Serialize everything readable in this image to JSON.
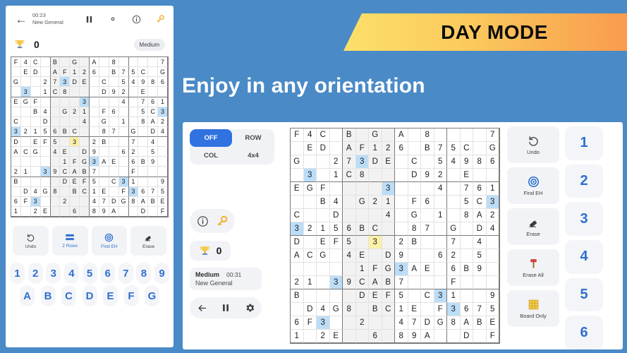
{
  "banner": {
    "label": "DAY MODE"
  },
  "headline": {
    "text": "Enjoy in any orientation"
  },
  "colors": {
    "background": "#4a8ac7",
    "accent_blue": "#2f72e0",
    "highlight_cell": "#bcddf7",
    "highlight_cell_yellow": "#fcf0a8",
    "banner_from": "#fbe06a",
    "banner_to": "#f99b4e",
    "panel_grey": "#f2f3f6"
  },
  "phone": {
    "topbar": {
      "back_icon": "arrow-left-icon",
      "time": "00:23",
      "puzzle_name": "New General",
      "pause_icon": "pause-icon",
      "settings_icon": "gear-icon",
      "info_icon": "info-icon",
      "key_icon": "key-icon"
    },
    "score": {
      "trophy_icon": "trophy-icon",
      "value": "0",
      "difficulty": "Medium"
    },
    "tools": [
      {
        "label": "Undo",
        "icon": "undo-icon",
        "active": false
      },
      {
        "label": "2 Rows",
        "icon": "rows-icon",
        "active": true
      },
      {
        "label": "Find EH",
        "icon": "target-icon",
        "active": false
      },
      {
        "label": "Erase",
        "icon": "eraser-icon",
        "active": false
      }
    ],
    "keypad_numbers": [
      "1",
      "2",
      "3",
      "4",
      "5",
      "6",
      "7",
      "8",
      "9"
    ],
    "keypad_letters": [
      "A",
      "B",
      "C",
      "D",
      "E",
      "F",
      "G"
    ]
  },
  "tablet": {
    "segments": [
      {
        "label": "OFF",
        "selected": true
      },
      {
        "label": "ROW",
        "selected": false
      },
      {
        "label": "COL",
        "selected": false
      },
      {
        "label": "4x4",
        "selected": false
      }
    ],
    "info_icon": "info-icon",
    "key_icon": "key-icon",
    "score": {
      "trophy_icon": "trophy-icon",
      "value": "0"
    },
    "meta": {
      "difficulty": "Medium",
      "time": "00:31",
      "puzzle_name": "New General"
    },
    "nav": {
      "back_icon": "arrow-left-icon",
      "pause_icon": "pause-icon",
      "settings_icon": "gear-icon"
    },
    "tools": [
      {
        "label": "Undo",
        "icon": "undo-icon"
      },
      {
        "label": "Find EH",
        "icon": "target-icon"
      },
      {
        "label": "Erase",
        "icon": "eraser-icon"
      },
      {
        "label": "Erase All",
        "icon": "hammer-icon"
      },
      {
        "label": "Board Only",
        "icon": "board-icon"
      }
    ],
    "keypad": [
      "1",
      "2",
      "3",
      "4",
      "5",
      "6"
    ]
  },
  "board": {
    "size": 16,
    "rows": [
      [
        "F",
        "4",
        "C",
        "",
        "B",
        "",
        "G",
        "",
        "A",
        "",
        "8",
        "",
        "",
        "",
        "",
        "7"
      ],
      [
        "",
        "E",
        "D",
        "",
        "A",
        "F",
        "1",
        "2",
        "6",
        "",
        "B",
        "7",
        "5",
        "C",
        "",
        "G"
      ],
      [
        "G",
        "",
        "",
        "2",
        "7",
        "3",
        "D",
        "E",
        "",
        "C",
        "",
        "5",
        "4",
        "9",
        "8",
        "6"
      ],
      [
        "",
        "3",
        "",
        "1",
        "C",
        "8",
        "",
        "",
        "",
        "D",
        "9",
        "2",
        "",
        "E",
        "",
        ""
      ],
      [
        "E",
        "G",
        "F",
        "",
        "",
        "",
        "",
        "3",
        "",
        "",
        "",
        "4",
        "",
        "7",
        "6",
        "1"
      ],
      [
        "",
        "",
        "B",
        "4",
        "",
        "G",
        "2",
        "1",
        "",
        "F",
        "6",
        "",
        "",
        "5",
        "C",
        "3"
      ],
      [
        "C",
        "",
        "",
        "D",
        "",
        "",
        "",
        "4",
        "",
        "G",
        "",
        "1",
        "",
        "8",
        "A",
        "2"
      ],
      [
        "3",
        "2",
        "1",
        "5",
        "6",
        "B",
        "C",
        "",
        "",
        "8",
        "7",
        "",
        "G",
        "",
        "D",
        "4"
      ],
      [
        "D",
        "",
        "E",
        "F",
        "5",
        "",
        "3",
        "",
        "2",
        "B",
        "",
        "",
        "7",
        "",
        "4",
        ""
      ],
      [
        "A",
        "C",
        "G",
        "",
        "4",
        "E",
        "",
        "D",
        "9",
        "",
        "",
        "6",
        "2",
        "",
        "5",
        ""
      ],
      [
        "",
        "",
        "",
        "",
        "",
        "1",
        "F",
        "G",
        "3",
        "A",
        "E",
        "",
        "6",
        "B",
        "9",
        ""
      ],
      [
        "2",
        "1",
        "",
        "3",
        "9",
        "C",
        "A",
        "B",
        "7",
        "",
        "",
        "",
        "F",
        "",
        "",
        ""
      ],
      [
        "B",
        "",
        "",
        "",
        "",
        "D",
        "E",
        "F",
        "5",
        "",
        "C",
        "3",
        "1",
        "",
        "",
        "9"
      ],
      [
        "",
        "D",
        "4",
        "G",
        "8",
        "",
        "B",
        "C",
        "1",
        "E",
        "",
        "F",
        "3",
        "6",
        "7",
        "5"
      ],
      [
        "6",
        "F",
        "3",
        "",
        "",
        "2",
        "",
        "",
        "4",
        "7",
        "D",
        "G",
        "8",
        "A",
        "B",
        "E"
      ],
      [
        "1",
        "",
        "2",
        "E",
        "",
        "",
        "6",
        "",
        "8",
        "9",
        "A",
        "",
        "",
        "D",
        "",
        "F"
      ]
    ],
    "highlight_blue": [
      [
        3,
        1
      ],
      [
        2,
        5
      ],
      [
        4,
        7
      ],
      [
        5,
        15
      ],
      [
        7,
        0
      ],
      [
        10,
        8
      ],
      [
        11,
        3
      ],
      [
        12,
        11
      ],
      [
        13,
        12
      ],
      [
        14,
        2
      ]
    ],
    "highlight_yellow": [
      [
        8,
        6
      ]
    ],
    "shaded_columns": [
      4,
      5,
      6,
      7
    ]
  }
}
